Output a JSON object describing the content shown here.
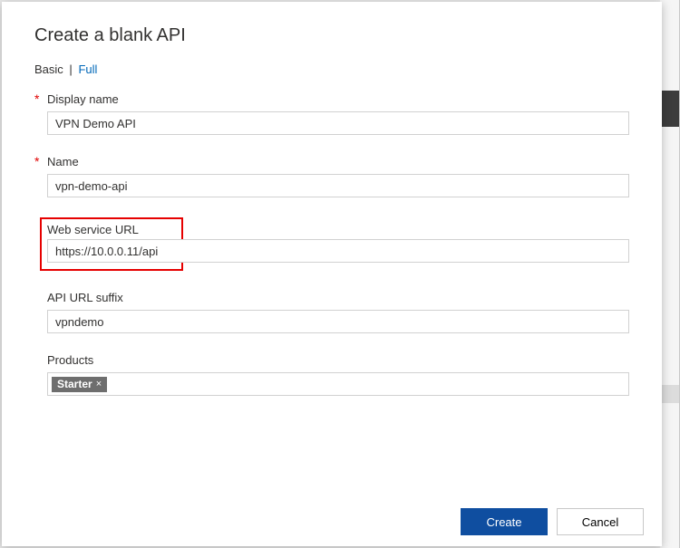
{
  "title": "Create a blank API",
  "tabs": {
    "basic": "Basic",
    "full": "Full",
    "sep": "|"
  },
  "fields": {
    "displayName": {
      "label": "Display name",
      "value": "VPN Demo API"
    },
    "name": {
      "label": "Name",
      "value": "vpn-demo-api"
    },
    "webUrl": {
      "label": "Web service URL",
      "value": "https://10.0.0.11/api"
    },
    "suffix": {
      "label": "API URL suffix",
      "value": "vpndemo"
    },
    "products": {
      "label": "Products",
      "tag": "Starter",
      "tagClose": "×"
    }
  },
  "buttons": {
    "create": "Create",
    "cancel": "Cancel"
  }
}
